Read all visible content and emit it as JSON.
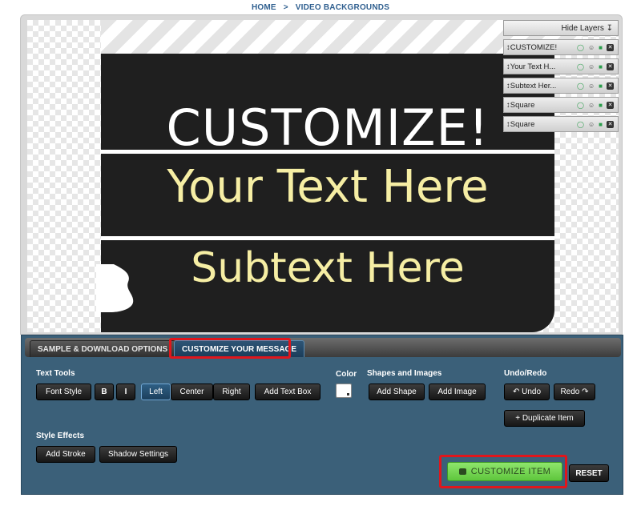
{
  "breadcrumb": {
    "home": "HOME",
    "separator": ">",
    "current": "VIDEO BACKGROUNDS"
  },
  "canvas": {
    "headline": "CUSTOMIZE!",
    "text_line": "Your Text Here",
    "subtext_line": "Subtext Here"
  },
  "layers": {
    "hide_label": "Hide Layers",
    "items": [
      {
        "name": "CUSTOMIZE!"
      },
      {
        "name": "Your Text H..."
      },
      {
        "name": "Subtext Her..."
      },
      {
        "name": "Square"
      },
      {
        "name": "Square"
      }
    ]
  },
  "tabs": [
    {
      "label": "SAMPLE & DOWNLOAD OPTIONS"
    },
    {
      "label": "CUSTOMIZE YOUR MESSAGE"
    }
  ],
  "toolbar": {
    "text_tools_label": "Text Tools",
    "font_style": "Font Style",
    "bold": "B",
    "italic": "I",
    "left": "Left",
    "center": "Center",
    "right": "Right",
    "add_text_box": "Add Text Box",
    "color_label": "Color",
    "shapes_label": "Shapes and Images",
    "add_shape": "Add Shape",
    "add_image": "Add Image",
    "undo_redo_label": "Undo/Redo",
    "undo": "↶ Undo",
    "redo": "Redo ↷",
    "duplicate_item": "+ Duplicate Item",
    "style_effects_label": "Style Effects",
    "add_stroke": "Add Stroke",
    "shadow_settings": "Shadow Settings",
    "customize_item": "CUSTOMIZE ITEM",
    "reset": "RESET"
  },
  "colors": {
    "panel_bg": "#3b6079",
    "board_bg": "#1f1f1f",
    "headline_text": "#ffffff",
    "body_text": "#f6eea4",
    "highlight_red": "#e0161c",
    "customize_green": "#6fd24a",
    "selected_text_color": "#ffffff"
  }
}
